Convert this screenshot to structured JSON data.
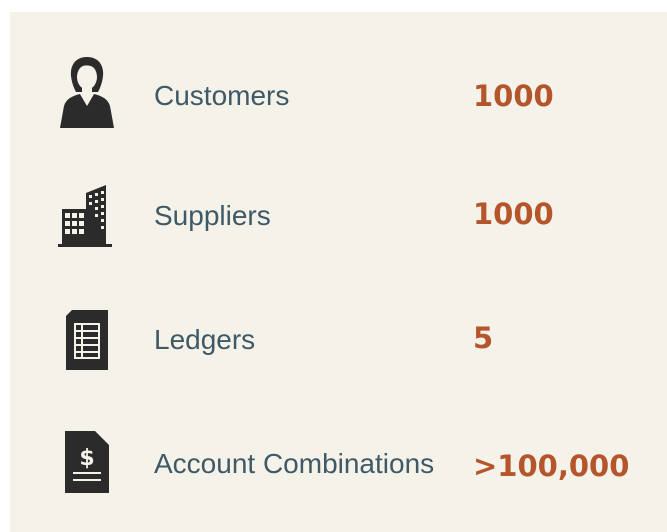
{
  "metrics": [
    {
      "icon": "person-icon",
      "label": "Customers",
      "value": "1000"
    },
    {
      "icon": "building-icon",
      "label": "Suppliers",
      "value": "1000"
    },
    {
      "icon": "ledger-icon",
      "label": "Ledgers",
      "value": "5"
    },
    {
      "icon": "dollar-document-icon",
      "label": "Account Combinations",
      "value": ">100,000"
    }
  ],
  "colors": {
    "background": "#f5f2ea",
    "label_text": "#3f5966",
    "value_text": "#b4552b",
    "icon": "#2b2b2b"
  }
}
